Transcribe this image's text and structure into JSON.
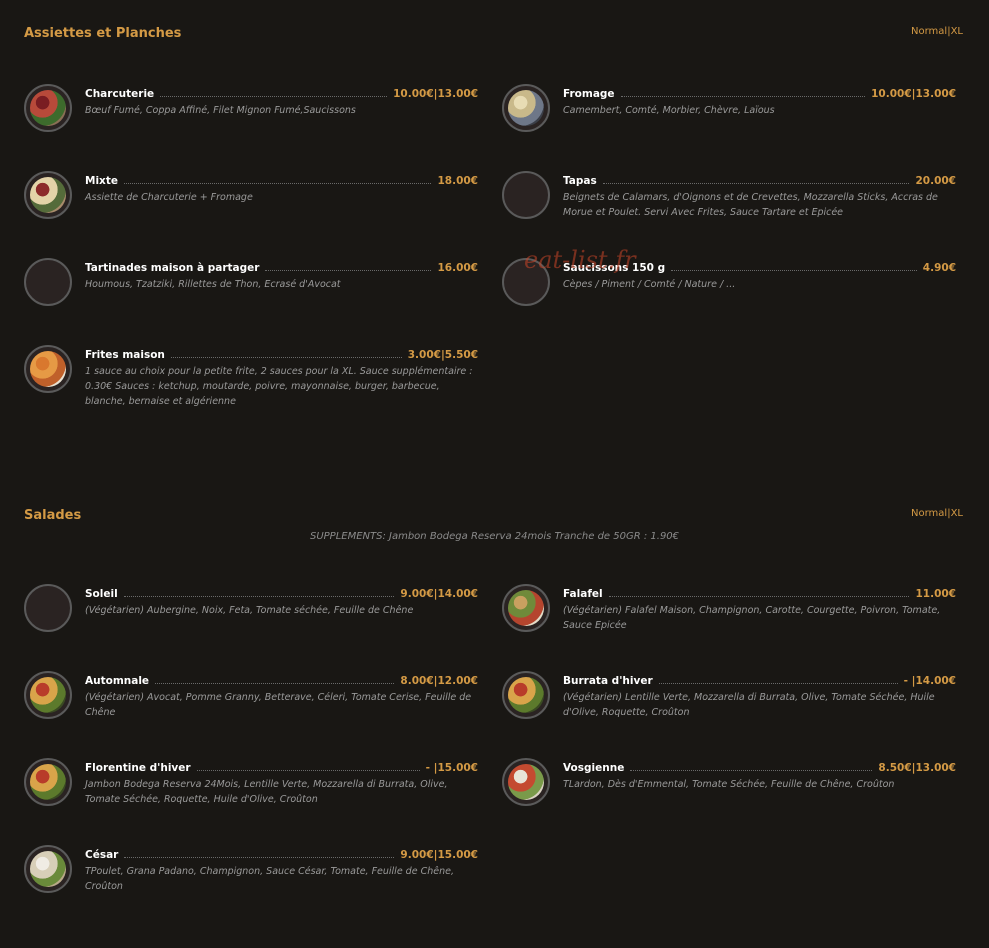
{
  "sections": [
    {
      "title": "Assiettes et Planches",
      "size_legend": "Normal|XL",
      "items": [
        {
          "name": "Charcuterie",
          "price": "10.00€|13.00€",
          "desc": "Bœuf Fumé, Coppa Affiné, Filet Mignon Fumé,Saucissons"
        },
        {
          "name": "Fromage",
          "price": "10.00€|13.00€",
          "desc": "Camembert, Comté, Morbier, Chèvre, Laïous"
        },
        {
          "name": "Mixte",
          "price": "18.00€",
          "desc": "Assiette de Charcuterie + Fromage"
        },
        {
          "name": "Tapas",
          "price": "20.00€",
          "desc": "Beignets de Calamars, d'Oignons et de Crevettes, Mozzarella Sticks, Accras de Morue et Poulet. Servi Avec Frites, Sauce Tartare et Epicée"
        },
        {
          "name": "Tartinades maison à partager",
          "price": "16.00€",
          "desc": "Houmous, Tzatziki, Rillettes de Thon, Ecrasé d'Avocat"
        },
        {
          "name": "Saucissons 150 g",
          "price": "4.90€",
          "desc": "Cèpes / Piment / Comté / Nature / ..."
        },
        {
          "name": "Frites maison",
          "price": "3.00€|5.50€",
          "desc": "1 sauce au choix pour la petite frite, 2 sauces pour la XL. Sauce supplémentaire : 0.30€ Sauces : ketchup, moutarde, poivre, mayonnaise, burger, barbecue, blanche, bernaise et algérienne"
        }
      ]
    },
    {
      "title": "Salades",
      "size_legend": "Normal|XL",
      "supplement": "SUPPLEMENTS: Jambon Bodega Reserva 24mois Tranche de 50GR : 1.90€",
      "items": [
        {
          "name": "Soleil",
          "price": "9.00€|14.00€",
          "desc": "(Végétarien) Aubergine, Noix, Feta, Tomate séchée, Feuille de Chêne"
        },
        {
          "name": "Falafel",
          "price": "11.00€",
          "desc": "(Végétarien) Falafel Maison, Champignon, Carotte, Courgette, Poivron, Tomate, Sauce Epicée"
        },
        {
          "name": "Automnale",
          "price": "8.00€|12.00€",
          "desc": "(Végétarien) Avocat, Pomme Granny, Betterave, Céleri, Tomate Cerise, Feuille de Chêne"
        },
        {
          "name": "Burrata d'hiver",
          "price": "- |14.00€",
          "desc": "(Végétarien) Lentille Verte, Mozzarella di Burrata, Olive, Tomate Séchée, Huile d'Olive, Roquette, Croûton"
        },
        {
          "name": "Florentine d'hiver",
          "price": "- |15.00€",
          "desc": "Jambon Bodega Reserva 24Mois, Lentille Verte, Mozzarella di Burrata, Olive, Tomate Séchée, Roquette, Huile d'Olive, Croûton"
        },
        {
          "name": "Vosgienne",
          "price": "8.50€|13.00€",
          "desc": "TLardon, Dès d'Emmental, Tomate Séchée, Feuille de Chêne, Croûton"
        },
        {
          "name": "César",
          "price": "9.00€|15.00€",
          "desc": "TPoulet, Grana Padano, Champignon, Sauce César, Tomate, Feuille de Chêne, Croûton"
        }
      ]
    }
  ],
  "watermark": "eat-list.fr",
  "colors": {
    "background": "#191714",
    "accent": "#d49a45",
    "text": "#ffffff",
    "muted": "#9a9a9a"
  }
}
